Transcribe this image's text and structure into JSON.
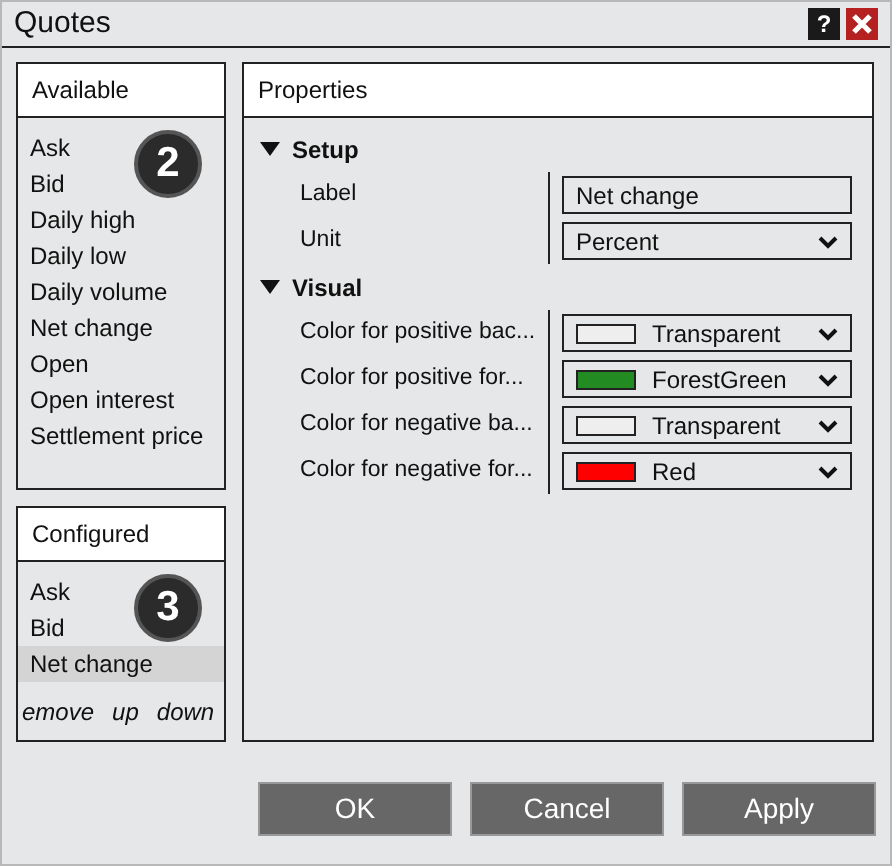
{
  "window": {
    "title": "Quotes",
    "help": "?"
  },
  "available": {
    "title": "Available",
    "badge": "2",
    "items": [
      {
        "label": "Ask",
        "selected": false
      },
      {
        "label": "Bid",
        "selected": false
      },
      {
        "label": "Daily high",
        "selected": false
      },
      {
        "label": "Daily low",
        "selected": false
      },
      {
        "label": "Daily volume",
        "selected": false
      },
      {
        "label": "Net change",
        "selected": false
      },
      {
        "label": "Open",
        "selected": false
      },
      {
        "label": "Open interest",
        "selected": false
      },
      {
        "label": "Settlement price",
        "selected": false
      }
    ]
  },
  "configured": {
    "title": "Configured",
    "badge": "3",
    "items": [
      {
        "label": "Ask",
        "selected": false
      },
      {
        "label": "Bid",
        "selected": false
      },
      {
        "label": "Net change",
        "selected": true
      }
    ],
    "actions": [
      "emove",
      "up",
      "down"
    ]
  },
  "properties": {
    "title": "Properties",
    "groups": [
      {
        "title": "Setup",
        "expanded": true,
        "rows": [
          {
            "label": "Label",
            "kind": "text",
            "value": "Net change"
          },
          {
            "label": "Unit",
            "kind": "select",
            "value": "Percent"
          }
        ]
      },
      {
        "title": "Visual",
        "expanded": true,
        "rows": [
          {
            "label": "Color for positive bac...",
            "kind": "color",
            "value": "Transparent",
            "color": "#eeeeee"
          },
          {
            "label": "Color for positive for...",
            "kind": "color",
            "value": "ForestGreen",
            "color": "#228b22"
          },
          {
            "label": "Color for negative ba...",
            "kind": "color",
            "value": "Transparent",
            "color": "#eeeeee"
          },
          {
            "label": "Color for negative for...",
            "kind": "color",
            "value": "Red",
            "color": "#ff0000"
          }
        ]
      }
    ]
  },
  "buttons": [
    "OK",
    "Cancel",
    "Apply"
  ]
}
